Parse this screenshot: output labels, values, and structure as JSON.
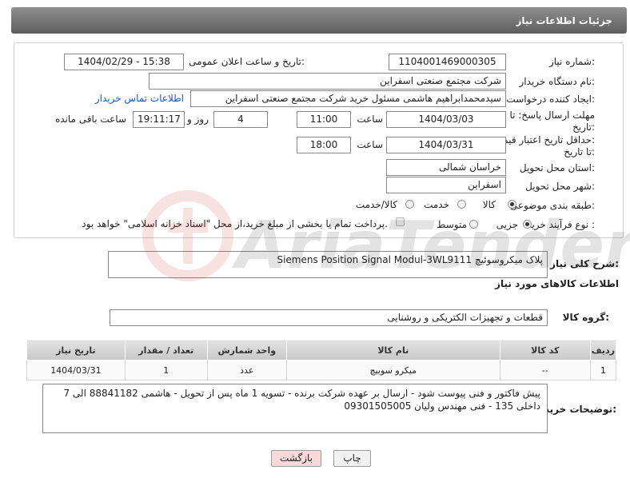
{
  "header": {
    "title": "جزئیات اطلاعات نیاز"
  },
  "form": {
    "need_number_label": "شماره نیاز:",
    "need_number": "1104001469000305",
    "announce_label": "تاریخ و ساعت اعلان عمومی:",
    "announce_value": "1404/02/29 - 15:38",
    "buyer_org_label": "نام دستگاه خریدار:",
    "buyer_org": "شرکت مجتمع صنعتی اسفراین",
    "creator_label": "ایجاد کننده درخواست:",
    "creator": "سیدمحمدابراهیم هاشمی مسئول خرید شرکت مجتمع صنعتی اسفراین",
    "contact_link": "اطلاعات تماس خریدار",
    "deadline_label_1": "مهلت ارسال پاسخ: تا",
    "deadline_label_2": "تاریخ:",
    "deadline_date": "1404/03/03",
    "time_label": "ساعت",
    "deadline_time": "11:00",
    "days_value": "4",
    "days_label": "روز و",
    "remaining_time": "19:11:17",
    "remaining_label": "ساعت باقی مانده",
    "validity_label_1": "حداقل تاریخ اعتبار قیمت:",
    "validity_label_2": "تا تاریخ:",
    "validity_date": "1404/03/31",
    "validity_time": "18:00",
    "province_label": "استان محل تحویل:",
    "province": "خراسان شمالی",
    "city_label": "شهر محل تحویل:",
    "city": "اسفراین",
    "category_label": "طبقه بندی موضوعی:",
    "category_options": [
      "کالا",
      "خدمت",
      "کالا/خدمت"
    ],
    "process_label": "نوع فرآیند خرید :",
    "process_options": [
      "جزیی",
      "متوسط"
    ],
    "payment_note": "پرداخت تمام یا بخشی از مبلغ خرید،از محل \"اسناد خزانه اسلامی\" خواهد بود."
  },
  "description": {
    "label": "شرح کلی نیاز:",
    "value": "پلاک میکروسوئیچ Siemens Position Signal Modul-3WL9111"
  },
  "goods_section": {
    "title": "اطلاعات کالاهای مورد نیاز",
    "group_label": "گروه کالا:",
    "group_value": "قطعات و تجهیزات الکتریکی و روشنایی"
  },
  "table": {
    "headers": [
      "ردیف",
      "کد کالا",
      "نام کالا",
      "واحد شمارش",
      "تعداد / مقدار",
      "تاریخ نیاز"
    ],
    "rows": [
      [
        "1",
        "--",
        "میکرو سوییچ",
        "عدد",
        "1",
        "1404/03/31"
      ]
    ]
  },
  "buyer_notes": {
    "label": "توضیحات خریدار:",
    "value": "پیش فاکتور و فنی پیوست شود - ارسال بر عهده شرکت برنده - تسویه 1 ماه پس از تحویل - هاشمی 88841182 الی 7 داخلی 135 - فنی مهندس ولیان 09301505005"
  },
  "buttons": {
    "print": "چاپ",
    "back": "بازگشت"
  },
  "watermark": {
    "text": "AriaTender.net"
  },
  "colors": {
    "header_bg": "#6e6e6e",
    "link": "#1a55c2",
    "back_button_bg": "#f7d9d9"
  }
}
